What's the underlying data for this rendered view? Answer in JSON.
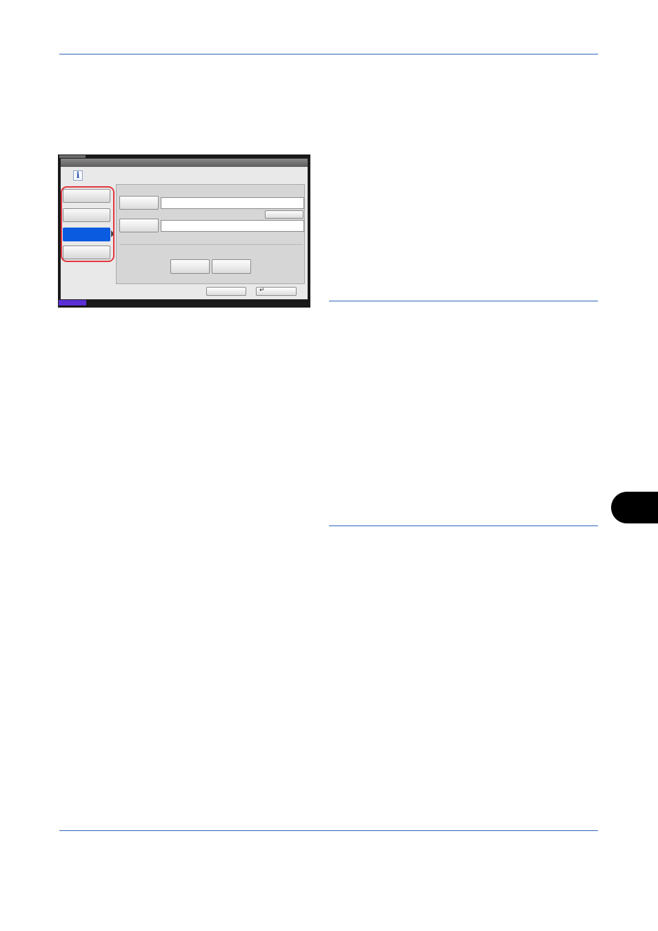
{
  "page": {
    "rule_color": "#2a63b8",
    "chapter_tab_color": "#000000"
  },
  "panel": {
    "info_icon_glyph": "i",
    "accent_color": "#0a5be0",
    "highlight_color": "#e0353d",
    "status_color": "#5b2fd6",
    "tabs": [
      {
        "label": "",
        "active": false
      },
      {
        "label": "",
        "active": false
      },
      {
        "label": "",
        "active": true
      },
      {
        "label": "",
        "active": false
      }
    ],
    "fields": [
      {
        "button_label": "",
        "value": ""
      },
      {
        "button_label": "",
        "value": ""
      }
    ],
    "clear_button_label": "",
    "action_buttons": [
      "",
      ""
    ],
    "footer": {
      "cancel_label": "",
      "ok_glyph": "↵",
      "ok_label": ""
    }
  }
}
